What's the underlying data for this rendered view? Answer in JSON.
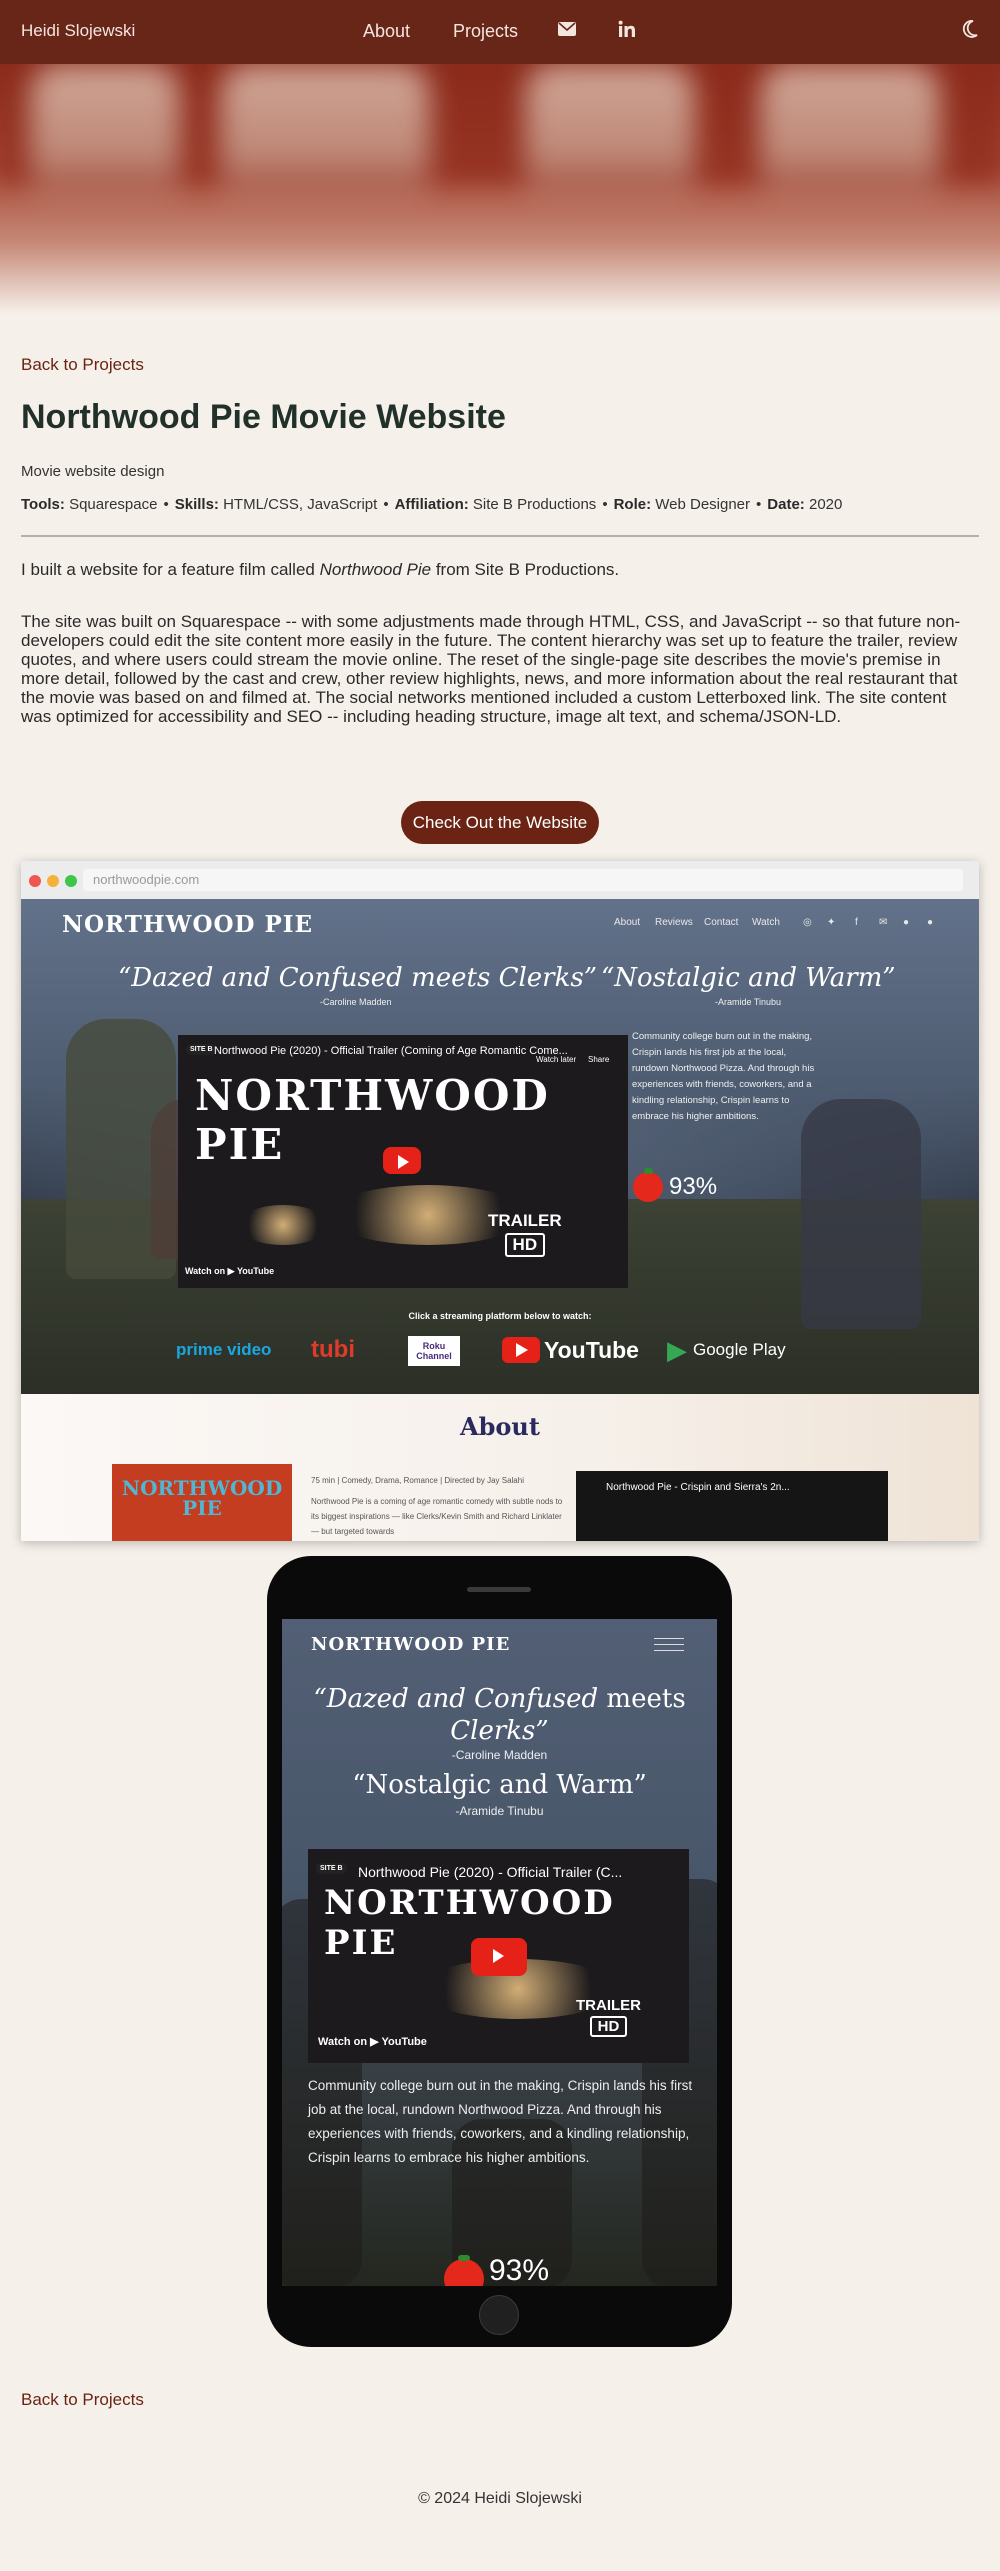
{
  "nav": {
    "brand": "Heidi Slojewski",
    "links": [
      "About",
      "Projects"
    ],
    "icons": [
      "envelope-icon",
      "linkedin-icon",
      "moon-icon"
    ]
  },
  "back_link_top": "Back to Projects",
  "back_link_bottom": "Back to Projects",
  "title": "Northwood Pie Movie Website",
  "subtitle": "Movie website design",
  "meta": {
    "tools_label": "Tools:",
    "tools": "Squarespace",
    "skills_label": "Skills:",
    "skills": "HTML/CSS, JavaScript",
    "affiliation_label": "Affiliation:",
    "affiliation": "Site B Productions",
    "role_label": "Role:",
    "role": "Web Designer",
    "date_label": "Date:",
    "date": "2020",
    "separator": "•"
  },
  "intro": {
    "before": "I built a website for a feature film called ",
    "film": "Northwood Pie",
    "after": " from Site B Productions."
  },
  "body": "The site was built on Squarespace -- with some adjustments made through HTML, CSS, and JavaScript -- so that future non-developers could edit the site content more easily in the future. The content hierarchy was set up to feature the trailer, review quotes, and where users could stream the movie online. The reset of the single-page site describes the movie's premise in more detail, followed by the cast and crew, other review highlights, news, and more information about the real restaurant that the movie was based on and filmed at. The social networks mentioned included a custom Letterboxed link. The site content was optimized for accessibility and SEO -- including heading structure, image alt text, and schema/JSON-LD.",
  "cta": "Check Out the Website",
  "browser": {
    "url": "northwoodpie.com",
    "dot_colors": [
      "#f0564d",
      "#f5b23a",
      "#3ec64a"
    ],
    "site": {
      "logo": "NORTHWOOD PIE",
      "nav": [
        "About",
        "Reviews",
        "Contact",
        "Watch"
      ],
      "quote1": "“Dazed and Confused meets Clerks”",
      "quote1_author": "-Caroline Madden",
      "quote2": "“Nostalgic and Warm”",
      "quote2_author": "-Aramide Tinubu",
      "video_title": "Northwood Pie (2020) - Official Trailer (Coming of Age Romantic Come...",
      "video_big": "NORTHWOOD PIE",
      "watch_later": "Watch later",
      "share": "Share",
      "trailer": "TRAILER",
      "hd": "HD",
      "watch_on": "Watch on",
      "youtube": "YouTube",
      "channel_badge": "SITE B",
      "description": "Community college burn out in the making, Crispin lands his first job at the local, rundown Northwood Pizza. And through his experiences with friends, coworkers, and a kindling relationship, Crispin learns to embrace his higher ambitions.",
      "score": "93%",
      "stream_label": "Click a streaming platform below to watch:",
      "platforms": [
        "prime video",
        "tubi",
        "Roku Channel",
        "YouTube",
        "Google Play"
      ],
      "about_heading": "About",
      "poster_text": "NORTHWOOD PIE",
      "about_meta": "75 min | Comedy, Drama, Romance | Directed by Jay Salahi",
      "about_text": "Northwood Pie is a coming of age romantic comedy with subtle nods to its biggest inspirations — like Clerks/Kevin Smith and Richard Linklater — but targeted towards",
      "video2_title": "Northwood Pie - Crispin and Sierra's 2n..."
    }
  },
  "phone": {
    "logo": "NORTHWOOD PIE",
    "quote1_italic": "“Dazed and Confused",
    "quote1_rest": " meets",
    "quote1_line2": "Clerks”",
    "quote1_author": "-Caroline Madden",
    "quote2": "“Nostalgic and Warm”",
    "quote2_author": "-Aramide Tinubu",
    "video_title": "Northwood Pie (2020) - Official Trailer (C...",
    "video_big": "NORTHWOOD PIE",
    "trailer": "TRAILER",
    "hd": "HD",
    "watch_on": "Watch on",
    "youtube": "YouTube",
    "channel_badge": "SITE B",
    "description": "Community college burn out in the making, Crispin lands his first job at the local, rundown Northwood Pizza. And through his experiences with friends, coworkers, and a kindling relationship, Crispin learns to embrace his higher ambitions.",
    "score": "93%"
  },
  "footer": "© 2024 Heidi Slojewski",
  "colors": {
    "nav_bg": "#672617",
    "accent": "#6b2414",
    "page_bg": "#f6f0ea",
    "heading": "#22302a"
  }
}
